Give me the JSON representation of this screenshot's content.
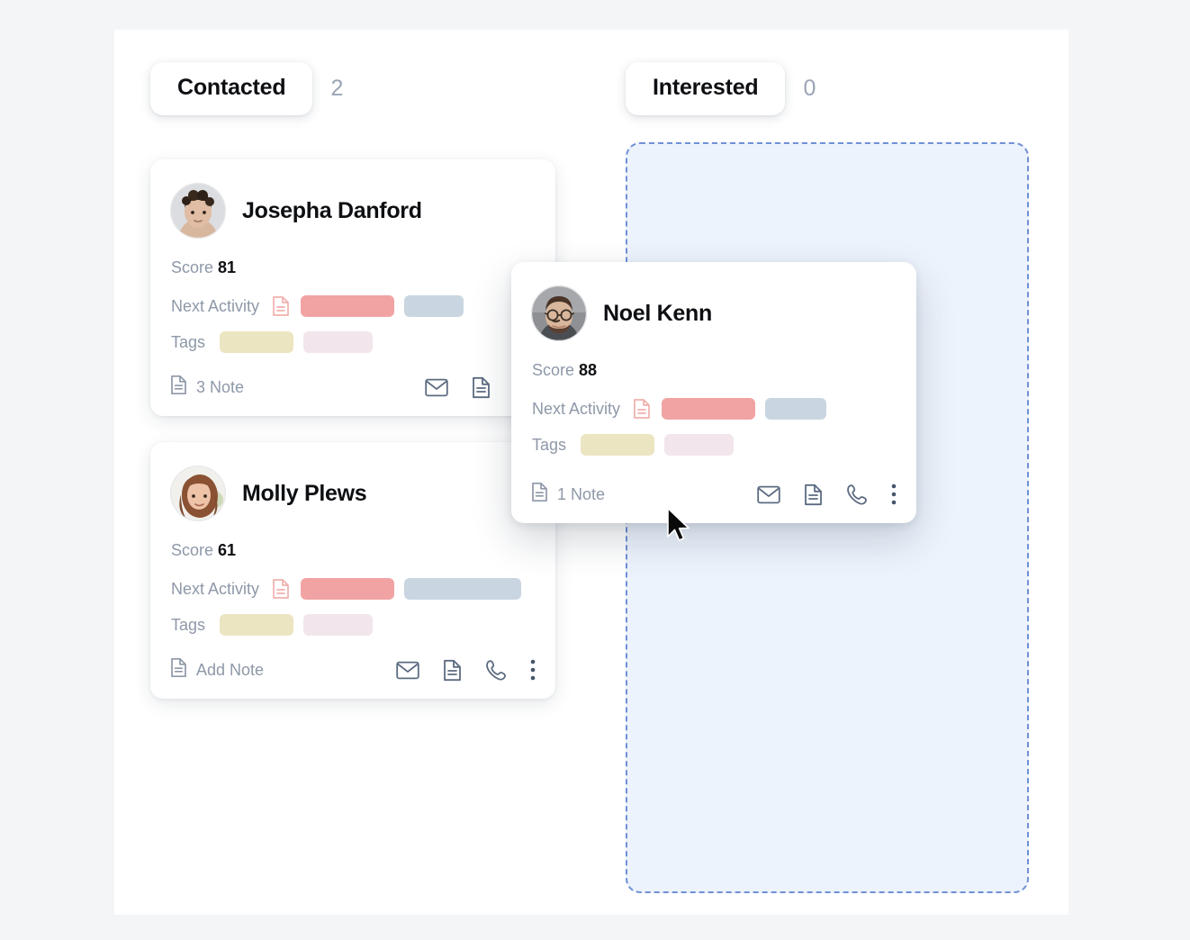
{
  "page": {
    "background_color": "#f4f5f6",
    "panel_color": "#ffffff"
  },
  "board": {
    "columns": [
      {
        "name": "contacted",
        "label": "Contacted",
        "count": "2"
      },
      {
        "name": "interested",
        "label": "Interested",
        "count": "0"
      }
    ]
  },
  "labels": {
    "score": "Score",
    "next_activity": "Next Activity",
    "tags": "Tags"
  },
  "cards": {
    "josepha": {
      "name": "Josepha Danford",
      "score": "81",
      "note_label": "3 Note",
      "avatar_name": "avatar-josepha-danford"
    },
    "molly": {
      "name": "Molly Plews",
      "score": "61",
      "note_label": "Add Note",
      "avatar_name": "avatar-molly-plews"
    },
    "noel": {
      "name": "Noel Kenn",
      "score": "88",
      "note_label": "1 Note",
      "avatar_name": "avatar-noel-kenn"
    }
  },
  "icons": {
    "note": "note-icon",
    "email": "email-icon",
    "document": "document-icon",
    "phone": "phone-icon",
    "more": "more-vertical-icon",
    "activity_doc": "activity-document-icon",
    "cursor": "mouse-cursor-icon"
  },
  "colors": {
    "activity_bar_primary": "#f1a3a3",
    "activity_bar_secondary": "#c9d6e1",
    "tag_bar_primary": "#ece5c2",
    "tag_bar_secondary": "#f2e6ec",
    "drop_zone_fill": "#edf3fc",
    "drop_zone_border": "#6f90d6",
    "muted_text": "#8e98a8",
    "icon_stroke": "#5c6b81",
    "count_text": "#9aa4b5"
  }
}
